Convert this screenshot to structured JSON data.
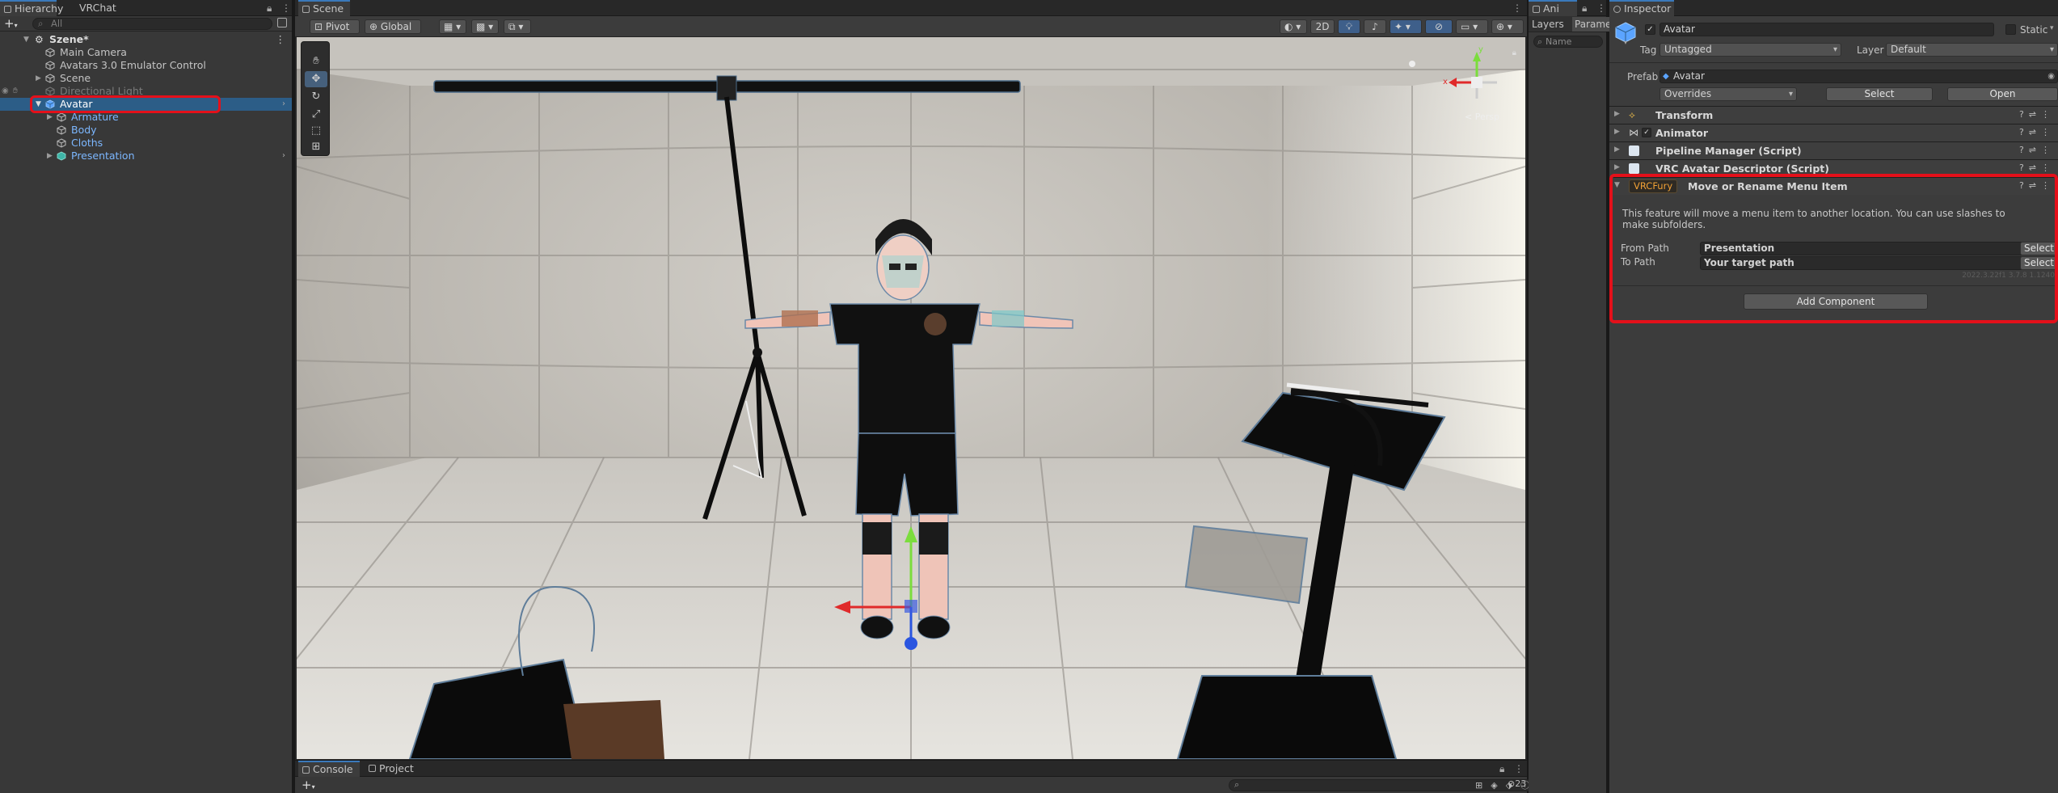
{
  "hierarchy": {
    "tabs": [
      "Hierarchy",
      "VRChat SDK"
    ],
    "search_placeholder": "All",
    "add_label": "+",
    "items": [
      {
        "label": "Szene*"
      },
      {
        "label": "Main Camera"
      },
      {
        "label": "Avatars 3.0 Emulator Control"
      },
      {
        "label": "Scene"
      },
      {
        "label": "Directional Light"
      },
      {
        "label": "Avatar"
      },
      {
        "label": "Armature"
      },
      {
        "label": "Body"
      },
      {
        "label": "Cloths"
      },
      {
        "label": "Presentation"
      }
    ]
  },
  "scene": {
    "tab": "Scene",
    "toolbar": {
      "pivot": "Pivot",
      "global": "Global",
      "mode_2d": "2D"
    },
    "gizmo": {
      "x": "x",
      "y": "y",
      "persp": "< Persp"
    }
  },
  "console": {
    "tabs": [
      "Console",
      "Project"
    ],
    "add_label": "+",
    "badge_count": "23"
  },
  "animator": {
    "tab": "Ani",
    "subtabs": [
      "Layers",
      "Parame"
    ],
    "name_placeholder": "Name"
  },
  "inspector": {
    "tab": "Inspector",
    "object_name": "Avatar",
    "static_label": "Static",
    "tag_label": "Tag",
    "tag_value": "Untagged",
    "layer_label": "Layer",
    "layer_value": "Default",
    "prefab_label": "Prefab",
    "prefab_value": "Avatar",
    "overrides_label": "Overrides",
    "select_label": "Select",
    "open_label": "Open",
    "components": [
      {
        "name": "Transform"
      },
      {
        "name": "Animator"
      },
      {
        "name": "Pipeline Manager (Script)"
      },
      {
        "name": "VRC Avatar Descriptor (Script)"
      }
    ],
    "vrcfury": {
      "badge": "VRCFury",
      "title": "Move or Rename Menu Item",
      "description": "This feature will move a menu item to another location. You can use slashes to make subfolders.",
      "from_label": "From Path",
      "from_value": "Presentation",
      "to_label": "To Path",
      "to_value": "Your target path",
      "select_label": "Select",
      "version": "2022.3.22f1 3.7.8 1.1240"
    },
    "add_component_label": "Add Component"
  }
}
